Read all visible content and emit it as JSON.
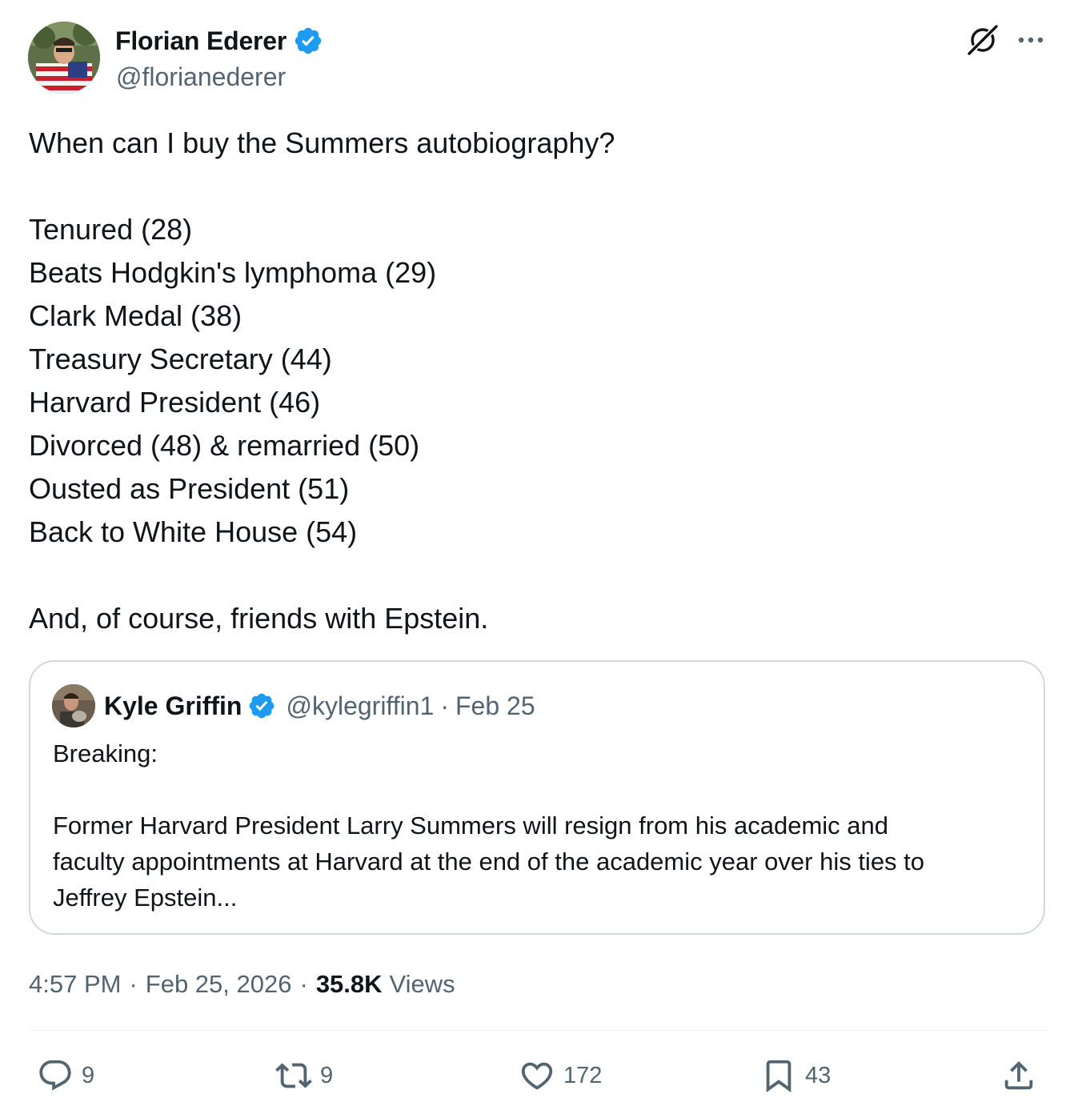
{
  "author": {
    "name": "Florian Ederer",
    "handle": "@florianederer"
  },
  "tweet": {
    "intro": "When can I buy the Summers autobiography?",
    "list": [
      "Tenured (28)",
      "Beats Hodgkin's lymphoma (29)",
      "Clark Medal (38)",
      "Treasury Secretary (44)",
      "Harvard President (46)",
      "Divorced (48) & remarried (50)",
      "Ousted as President (51)",
      "Back to White House (54)"
    ],
    "outro": "And, of course, friends with Epstein."
  },
  "quote": {
    "name": "Kyle Griffin",
    "handle": "@kylegriffin1",
    "separator": "·",
    "date": "Feb 25",
    "line1": "Breaking:",
    "body": [
      "Former Harvard President Larry Summers will resign from his academic and",
      "faculty appointments at Harvard at the end of the academic year over his ties to",
      "Jeffrey Epstein..."
    ]
  },
  "meta": {
    "time": "4:57 PM",
    "separator": "·",
    "date": "Feb 25, 2026",
    "views_count": "35.8K",
    "views_label": "Views"
  },
  "actions": {
    "replies": "9",
    "reposts": "9",
    "likes": "172",
    "bookmarks": "43"
  },
  "colors": {
    "text": "#0f1419",
    "secondary": "#536471",
    "verified": "#1d9bf0",
    "border": "#cfd9de"
  }
}
